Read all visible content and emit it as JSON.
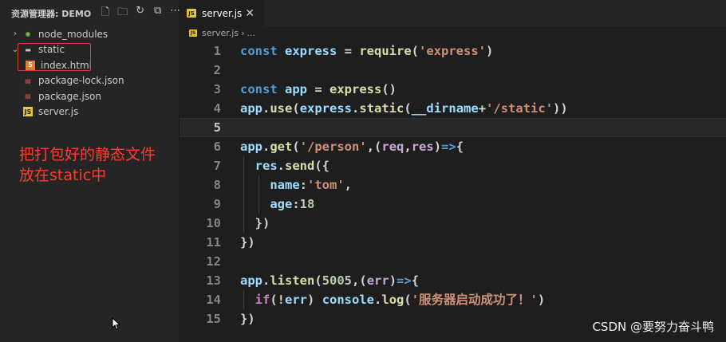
{
  "explorer": {
    "title": "资源管理器: DEMO",
    "tree": [
      {
        "label": "node_modules",
        "icon": "node-modules-icon",
        "indent": 0,
        "chevron": "›"
      },
      {
        "label": "static",
        "icon": "folder-icon",
        "indent": 0,
        "chevron": "⌄"
      },
      {
        "label": "index.html",
        "icon": "html-icon",
        "indent": 1,
        "chevron": ""
      },
      {
        "label": "package-lock.json",
        "icon": "json-icon",
        "indent": 0,
        "chevron": ""
      },
      {
        "label": "package.json",
        "icon": "json-icon",
        "indent": 0,
        "chevron": ""
      },
      {
        "label": "server.js",
        "icon": "js-icon",
        "indent": 0,
        "chevron": ""
      }
    ]
  },
  "annotation": {
    "line1": "把打包好的静态文件",
    "line2": "放在static中"
  },
  "tab": {
    "label": "server.js",
    "icon_text": "JS",
    "close": "✕"
  },
  "breadcrumb": {
    "file": "server.js",
    "sep": "›",
    "more": "..."
  },
  "code": [
    {
      "n": "1",
      "tokens": [
        [
          "kw",
          "const "
        ],
        [
          "var",
          "express"
        ],
        [
          "pl",
          " = "
        ],
        [
          "fn",
          "require"
        ],
        [
          "pl",
          "("
        ],
        [
          "str",
          "'express'"
        ],
        [
          "pl",
          ")"
        ]
      ]
    },
    {
      "n": "2",
      "tokens": []
    },
    {
      "n": "3",
      "tokens": [
        [
          "kw",
          "const "
        ],
        [
          "var",
          "app"
        ],
        [
          "pl",
          " = "
        ],
        [
          "fn",
          "express"
        ],
        [
          "pl",
          "()"
        ]
      ]
    },
    {
      "n": "4",
      "tokens": [
        [
          "var",
          "app"
        ],
        [
          "pl",
          "."
        ],
        [
          "fn",
          "use"
        ],
        [
          "pl",
          "("
        ],
        [
          "var",
          "express"
        ],
        [
          "pl",
          "."
        ],
        [
          "fn",
          "static"
        ],
        [
          "pl",
          "("
        ],
        [
          "var",
          "__dirname"
        ],
        [
          "pl",
          "+"
        ],
        [
          "str",
          "'/static'"
        ],
        [
          "pl",
          "))"
        ]
      ]
    },
    {
      "n": "5",
      "tokens": []
    },
    {
      "n": "6",
      "tokens": [
        [
          "var",
          "app"
        ],
        [
          "pl",
          "."
        ],
        [
          "fn",
          "get"
        ],
        [
          "pl",
          "("
        ],
        [
          "str",
          "'/person'"
        ],
        [
          "pl",
          ",("
        ],
        [
          "param",
          "req"
        ],
        [
          "pl",
          ","
        ],
        [
          "param",
          "res"
        ],
        [
          "pl",
          ")"
        ],
        [
          "kw",
          "=>"
        ],
        [
          "pl",
          "{"
        ]
      ]
    },
    {
      "n": "7",
      "tokens": [
        [
          "pl",
          "  "
        ],
        [
          "var",
          "res"
        ],
        [
          "pl",
          "."
        ],
        [
          "fn",
          "send"
        ],
        [
          "pl",
          "({"
        ]
      ]
    },
    {
      "n": "8",
      "tokens": [
        [
          "pl",
          "    "
        ],
        [
          "prop",
          "name"
        ],
        [
          "pl",
          ":"
        ],
        [
          "str",
          "'tom'"
        ],
        [
          "pl",
          ","
        ]
      ]
    },
    {
      "n": "9",
      "tokens": [
        [
          "pl",
          "    "
        ],
        [
          "prop",
          "age"
        ],
        [
          "pl",
          ":"
        ],
        [
          "num",
          "18"
        ]
      ]
    },
    {
      "n": "10",
      "tokens": [
        [
          "pl",
          "  })"
        ]
      ]
    },
    {
      "n": "11",
      "tokens": [
        [
          "pl",
          "})"
        ]
      ]
    },
    {
      "n": "12",
      "tokens": []
    },
    {
      "n": "13",
      "tokens": [
        [
          "var",
          "app"
        ],
        [
          "pl",
          "."
        ],
        [
          "fn",
          "listen"
        ],
        [
          "pl",
          "("
        ],
        [
          "num",
          "5005"
        ],
        [
          "pl",
          ",("
        ],
        [
          "param",
          "err"
        ],
        [
          "pl",
          ")"
        ],
        [
          "kw",
          "=>"
        ],
        [
          "pl",
          "{"
        ]
      ]
    },
    {
      "n": "14",
      "tokens": [
        [
          "pl",
          "  "
        ],
        [
          "ctl",
          "if"
        ],
        [
          "pl",
          "(!"
        ],
        [
          "var",
          "err"
        ],
        [
          "pl",
          ") "
        ],
        [
          "var",
          "console"
        ],
        [
          "pl",
          "."
        ],
        [
          "fn",
          "log"
        ],
        [
          "pl",
          "("
        ],
        [
          "str",
          "'服务器启动成功了！'"
        ],
        [
          "pl",
          ")"
        ]
      ]
    },
    {
      "n": "15",
      "tokens": [
        [
          "pl",
          "})"
        ]
      ]
    }
  ],
  "active_line": "5",
  "watermark": "CSDN @要努力奋斗鸭"
}
